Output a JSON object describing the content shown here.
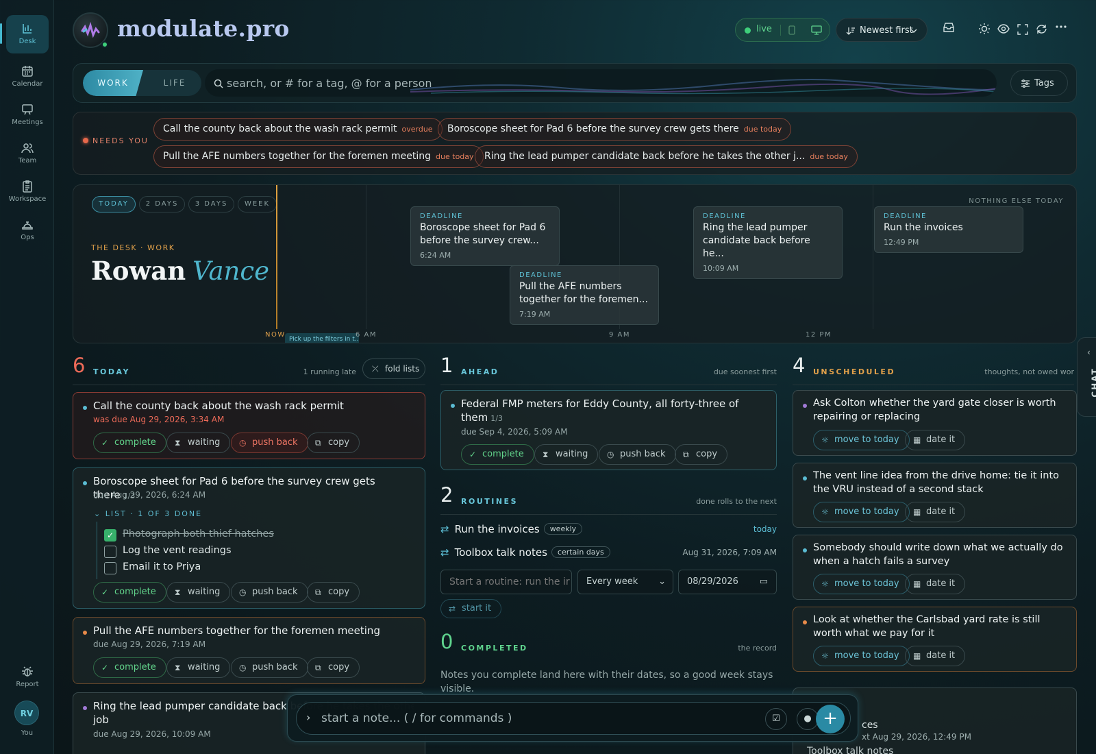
{
  "nav": {
    "items": [
      {
        "label": "Desk",
        "icon": "desk-icon",
        "active": true
      },
      {
        "label": "Calendar",
        "icon": "calendar-icon"
      },
      {
        "label": "Meetings",
        "icon": "meetings-icon"
      },
      {
        "label": "Team",
        "icon": "team-icon"
      },
      {
        "label": "Workspace",
        "icon": "workspace-icon"
      },
      {
        "label": "Ops",
        "icon": "ops-icon"
      }
    ],
    "report": "Report",
    "avatar": "RV",
    "you": "You"
  },
  "header": {
    "brand": "modulate.pro",
    "live": "live",
    "sort": "Newest first"
  },
  "filters": {
    "work": "WORK",
    "life": "LIFE",
    "search_placeholder": "search, or # for a tag, @ for a person",
    "tags": "Tags"
  },
  "needs": {
    "label": "NEEDS YOU",
    "chips": [
      {
        "text": "Call the county back about the wash rack permit",
        "tag": "overdue"
      },
      {
        "text": "Boroscope sheet for Pad 6 before the survey crew gets there",
        "tag": "due today"
      },
      {
        "text": "Pull the AFE numbers together for the foremen meeting",
        "tag": "due today"
      },
      {
        "text": "Ring the lead pumper candidate back before he takes the other j...",
        "tag": "due today"
      }
    ]
  },
  "timeline": {
    "ranges": [
      "TODAY",
      "2 DAYS",
      "3 DAYS",
      "WEEK"
    ],
    "crumbs": "THE DESK · WORK",
    "first": "Rowan",
    "last": "Vance",
    "nothing": "NOTHING ELSE TODAY",
    "now": "NOW",
    "tip": "Pick up the filters in t...",
    "ticks": [
      "6 AM",
      "9 AM",
      "12 PM"
    ],
    "events": [
      {
        "kind": "DEADLINE",
        "title": "Boroscope sheet for Pad 6 before the survey crew...",
        "time": "6:24 AM"
      },
      {
        "kind": "DEADLINE",
        "title": "Pull the AFE numbers together for the foremen...",
        "time": "7:19 AM"
      },
      {
        "kind": "DEADLINE",
        "title": "Ring the lead pumper candidate back before he...",
        "time": "10:09 AM"
      },
      {
        "kind": "DEADLINE",
        "title": "Run the invoices",
        "time": "12:49 PM"
      }
    ]
  },
  "actions": {
    "complete": "complete",
    "waiting": "waiting",
    "push": "push back",
    "copy": "copy",
    "move": "move to today",
    "date": "date it"
  },
  "today": {
    "count": "6",
    "name": "TODAY",
    "late": "1 running late",
    "fold": "fold lists",
    "t1": {
      "title": "Call the county back about the wash rack permit",
      "due": "was due Aug 29, 2026, 3:34 AM"
    },
    "t2": {
      "title": "Boroscope sheet for Pad 6 before the survey crew gets there",
      "frac": "1/3",
      "due": "due Aug 29, 2026, 6:24 AM",
      "list": "LIST · 1 OF 3 DONE",
      "items": [
        "Photograph both thief hatches",
        "Log the vent readings",
        "Email it to Priya"
      ]
    },
    "t3": {
      "title": "Pull the AFE numbers together for the foremen meeting",
      "due": "due Aug 29, 2026, 7:19 AM"
    },
    "t4": {
      "title": "Ring the lead pumper candidate back before he takes the other",
      "title2": "job",
      "due": "due Aug 29, 2026, 10:09 AM"
    }
  },
  "ahead": {
    "count": "1",
    "name": "AHEAD",
    "side": "due soonest first",
    "a1": {
      "title": "Federal FMP meters for Eddy County, all forty-three of",
      "title2": "them",
      "frac": "1/3",
      "due": "due Sep 4, 2026, 5:09 AM"
    }
  },
  "routines": {
    "count": "2",
    "name": "ROUTINES",
    "side": "done rolls to the next",
    "r1": {
      "title": "Run the invoices",
      "badge": "weekly",
      "when": "today"
    },
    "r2": {
      "title": "Toolbox talk notes",
      "badge": "certain days",
      "when": "Aug 31, 2026, 7:09 AM"
    },
    "new_placeholder": "Start a routine: run the ir",
    "freq": "Every week",
    "date": "08/29/2026",
    "start": "start it"
  },
  "completed": {
    "count": "0",
    "name": "COMPLETED",
    "side": "the record",
    "note": "Notes you complete land here with their dates, so a good week stays visible."
  },
  "unscheduled": {
    "count": "4",
    "name": "UNSCHEDULED",
    "side": "thoughts, not owed wor",
    "u1": "Ask Colton whether the yard gate closer is worth repairing or replacing",
    "u2": "The vent line idea from the drive home: tie it into the VRU instead of a second stack",
    "u3": "Somebody should write down what we actually do when a hatch fails a survey",
    "u4": "Look at whether the Carlsbad yard rate is still worth what we pay for it",
    "peek1": "ces",
    "peek2": "xt Aug 29, 2026, 12:49 PM",
    "peek3": "Toolbox talk notes"
  },
  "composer": {
    "placeholder": "start a note... ( / for commands )"
  },
  "chat": "CHAT"
}
